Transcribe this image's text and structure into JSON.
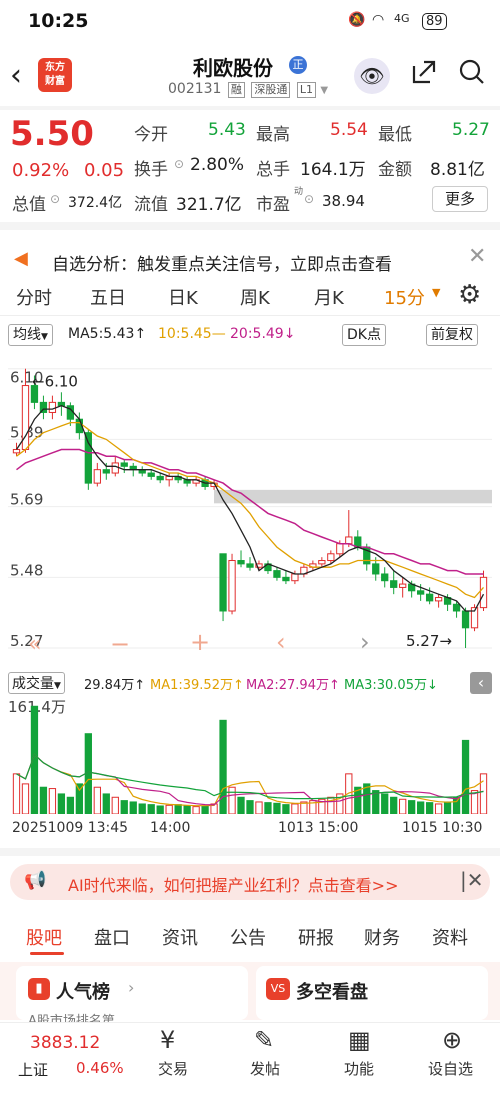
{
  "status": {
    "time": "10:25",
    "battery": "89",
    "network": "4G"
  },
  "header": {
    "back_icon": "chevron-left-icon",
    "logo_text1": "东方",
    "logo_text2": "财富",
    "name": "利欧股份",
    "badge": "正",
    "code": "002131",
    "tag1": "融",
    "tag2": "深股通",
    "tag3": "L1"
  },
  "quote": {
    "price": "5.50",
    "pct": "0.92%",
    "change": "0.05",
    "open_label": "今开",
    "open": "5.43",
    "high_label": "最高",
    "high": "5.54",
    "low_label": "最低",
    "low": "5.27",
    "turnover_label": "换手",
    "turnover": "2.80%",
    "volume_label": "总手",
    "volume": "164.1万",
    "amount_label": "金额",
    "amount": "8.81亿",
    "mcap_label": "总值",
    "mcap": "372.4亿",
    "float_label": "流值",
    "float": "321.7亿",
    "pe_label": "市盈",
    "pe_sup": "动",
    "pe": "38.94",
    "more": "更多"
  },
  "alert": {
    "text": "自选分析：触发重点关注信号，立即点击查看"
  },
  "periods": [
    "分时",
    "五日",
    "日K",
    "周K",
    "月K",
    "15分"
  ],
  "toolbar": {
    "indicator": "均线",
    "ma5": "MA5:5.43",
    "ma10": "10:5.45",
    "ma20": "20:5.49",
    "dk": "DK点",
    "adj": "前复权"
  },
  "chart_data": {
    "type": "candlestick",
    "title": "",
    "yticks": [
      "6.10",
      "5.89",
      "5.69",
      "5.48",
      "5.27"
    ],
    "ylim": [
      5.27,
      6.12
    ],
    "annotations": {
      "high": "6.10",
      "low": "5.27"
    },
    "candles": [
      [
        5.85,
        5.88,
        5.84,
        5.86
      ],
      [
        5.86,
        6.1,
        5.85,
        6.05
      ],
      [
        6.05,
        6.08,
        5.98,
        6.0
      ],
      [
        6.0,
        6.02,
        5.95,
        5.97
      ],
      [
        5.97,
        6.02,
        5.95,
        6.0
      ],
      [
        6.0,
        6.03,
        5.96,
        5.99
      ],
      [
        5.99,
        6.0,
        5.93,
        5.95
      ],
      [
        5.95,
        5.97,
        5.89,
        5.91
      ],
      [
        5.91,
        5.92,
        5.74,
        5.76
      ],
      [
        5.76,
        5.82,
        5.75,
        5.8
      ],
      [
        5.8,
        5.82,
        5.77,
        5.79
      ],
      [
        5.79,
        5.84,
        5.78,
        5.82
      ],
      [
        5.82,
        5.83,
        5.79,
        5.81
      ],
      [
        5.81,
        5.82,
        5.78,
        5.8
      ],
      [
        5.8,
        5.81,
        5.78,
        5.79
      ],
      [
        5.79,
        5.8,
        5.77,
        5.78
      ],
      [
        5.78,
        5.79,
        5.76,
        5.77
      ],
      [
        5.77,
        5.79,
        5.75,
        5.78
      ],
      [
        5.78,
        5.79,
        5.76,
        5.77
      ],
      [
        5.77,
        5.78,
        5.75,
        5.76
      ],
      [
        5.76,
        5.78,
        5.75,
        5.77
      ],
      [
        5.77,
        5.78,
        5.74,
        5.75
      ],
      [
        5.75,
        5.77,
        5.74,
        5.76
      ],
      [
        5.55,
        5.55,
        5.35,
        5.38
      ],
      [
        5.38,
        5.55,
        5.37,
        5.53
      ],
      [
        5.53,
        5.56,
        5.51,
        5.52
      ],
      [
        5.52,
        5.54,
        5.5,
        5.51
      ],
      [
        5.51,
        5.53,
        5.5,
        5.52
      ],
      [
        5.52,
        5.53,
        5.49,
        5.5
      ],
      [
        5.5,
        5.51,
        5.47,
        5.48
      ],
      [
        5.48,
        5.5,
        5.46,
        5.47
      ],
      [
        5.47,
        5.5,
        5.46,
        5.49
      ],
      [
        5.49,
        5.52,
        5.48,
        5.51
      ],
      [
        5.51,
        5.53,
        5.5,
        5.52
      ],
      [
        5.52,
        5.54,
        5.51,
        5.53
      ],
      [
        5.53,
        5.56,
        5.52,
        5.55
      ],
      [
        5.55,
        5.59,
        5.54,
        5.58
      ],
      [
        5.58,
        5.68,
        5.57,
        5.6
      ],
      [
        5.6,
        5.62,
        5.56,
        5.57
      ],
      [
        5.57,
        5.58,
        5.5,
        5.52
      ],
      [
        5.52,
        5.54,
        5.47,
        5.49
      ],
      [
        5.49,
        5.51,
        5.45,
        5.47
      ],
      [
        5.47,
        5.5,
        5.43,
        5.45
      ],
      [
        5.45,
        5.48,
        5.42,
        5.46
      ],
      [
        5.46,
        5.47,
        5.42,
        5.44
      ],
      [
        5.44,
        5.46,
        5.41,
        5.43
      ],
      [
        5.43,
        5.45,
        5.4,
        5.41
      ],
      [
        5.41,
        5.43,
        5.39,
        5.42
      ],
      [
        5.42,
        5.43,
        5.38,
        5.4
      ],
      [
        5.4,
        5.41,
        5.36,
        5.38
      ],
      [
        5.38,
        5.39,
        5.27,
        5.33
      ],
      [
        5.33,
        5.4,
        5.32,
        5.39
      ],
      [
        5.39,
        5.5,
        5.38,
        5.48
      ]
    ],
    "ma5": [
      5.86,
      5.9,
      5.95,
      5.98,
      5.98,
      5.99,
      5.98,
      5.95,
      5.88,
      5.84,
      5.81,
      5.81,
      5.8,
      5.8,
      5.8,
      5.8,
      5.79,
      5.78,
      5.78,
      5.77,
      5.77,
      5.76,
      5.76,
      5.71,
      5.67,
      5.62,
      5.57,
      5.5,
      5.52,
      5.51,
      5.5,
      5.49,
      5.49,
      5.5,
      5.51,
      5.52,
      5.54,
      5.56,
      5.57,
      5.56,
      5.55,
      5.53,
      5.5,
      5.48,
      5.46,
      5.45,
      5.44,
      5.43,
      5.42,
      5.41,
      5.38,
      5.38,
      5.43
    ],
    "ma10": [
      5.84,
      5.86,
      5.89,
      5.91,
      5.92,
      5.93,
      5.94,
      5.94,
      5.92,
      5.9,
      5.89,
      5.87,
      5.85,
      5.83,
      5.82,
      5.81,
      5.8,
      5.79,
      5.79,
      5.78,
      5.78,
      5.77,
      5.76,
      5.74,
      5.72,
      5.7,
      5.67,
      5.63,
      5.6,
      5.57,
      5.55,
      5.53,
      5.52,
      5.51,
      5.51,
      5.51,
      5.52,
      5.52,
      5.53,
      5.53,
      5.53,
      5.53,
      5.52,
      5.51,
      5.5,
      5.49,
      5.48,
      5.47,
      5.46,
      5.45,
      5.43,
      5.42,
      5.45
    ],
    "ma20": [
      5.8,
      5.82,
      5.83,
      5.84,
      5.85,
      5.86,
      5.86,
      5.86,
      5.85,
      5.85,
      5.84,
      5.84,
      5.83,
      5.83,
      5.82,
      5.82,
      5.81,
      5.8,
      5.8,
      5.79,
      5.79,
      5.78,
      5.77,
      5.76,
      5.74,
      5.73,
      5.71,
      5.69,
      5.67,
      5.66,
      5.65,
      5.64,
      5.62,
      5.61,
      5.6,
      5.59,
      5.58,
      5.58,
      5.57,
      5.57,
      5.56,
      5.55,
      5.55,
      5.54,
      5.53,
      5.52,
      5.52,
      5.51,
      5.5,
      5.5,
      5.49,
      5.49,
      5.49
    ],
    "volume": {
      "label": "成交量",
      "current": "29.84万",
      "ma1": "MA1:39.52万",
      "ma2": "MA2:27.94万",
      "ma3": "MA3:30.05万",
      "max_label": "161.4万",
      "ymax": 161.4,
      "values": [
        60,
        45,
        161,
        40,
        38,
        30,
        25,
        45,
        120,
        40,
        30,
        25,
        20,
        18,
        15,
        14,
        12,
        13,
        14,
        12,
        11,
        12,
        15,
        140,
        40,
        25,
        20,
        18,
        17,
        16,
        14,
        15,
        18,
        20,
        22,
        25,
        30,
        60,
        40,
        45,
        35,
        30,
        25,
        22,
        20,
        18,
        17,
        15,
        18,
        25,
        110,
        35,
        60
      ]
    },
    "xticks": [
      "20251009 13:45",
      "14:00",
      "1013 15:00",
      "1015 10:30"
    ]
  },
  "banner": {
    "text": "AI时代来临，如何把握产业红利？点击查看>>"
  },
  "tabs2": [
    "股吧",
    "盘口",
    "资讯",
    "公告",
    "研报",
    "财务",
    "资料"
  ],
  "cards": {
    "c1": "人气榜",
    "c2": "多空看盘",
    "c1sub": "A股市场排名第"
  },
  "bottom": {
    "index": "3883.12",
    "index_name": "上证",
    "index_pct": "0.46%",
    "b1": "交易",
    "b2": "发帖",
    "b3": "功能",
    "b4": "设自选"
  }
}
